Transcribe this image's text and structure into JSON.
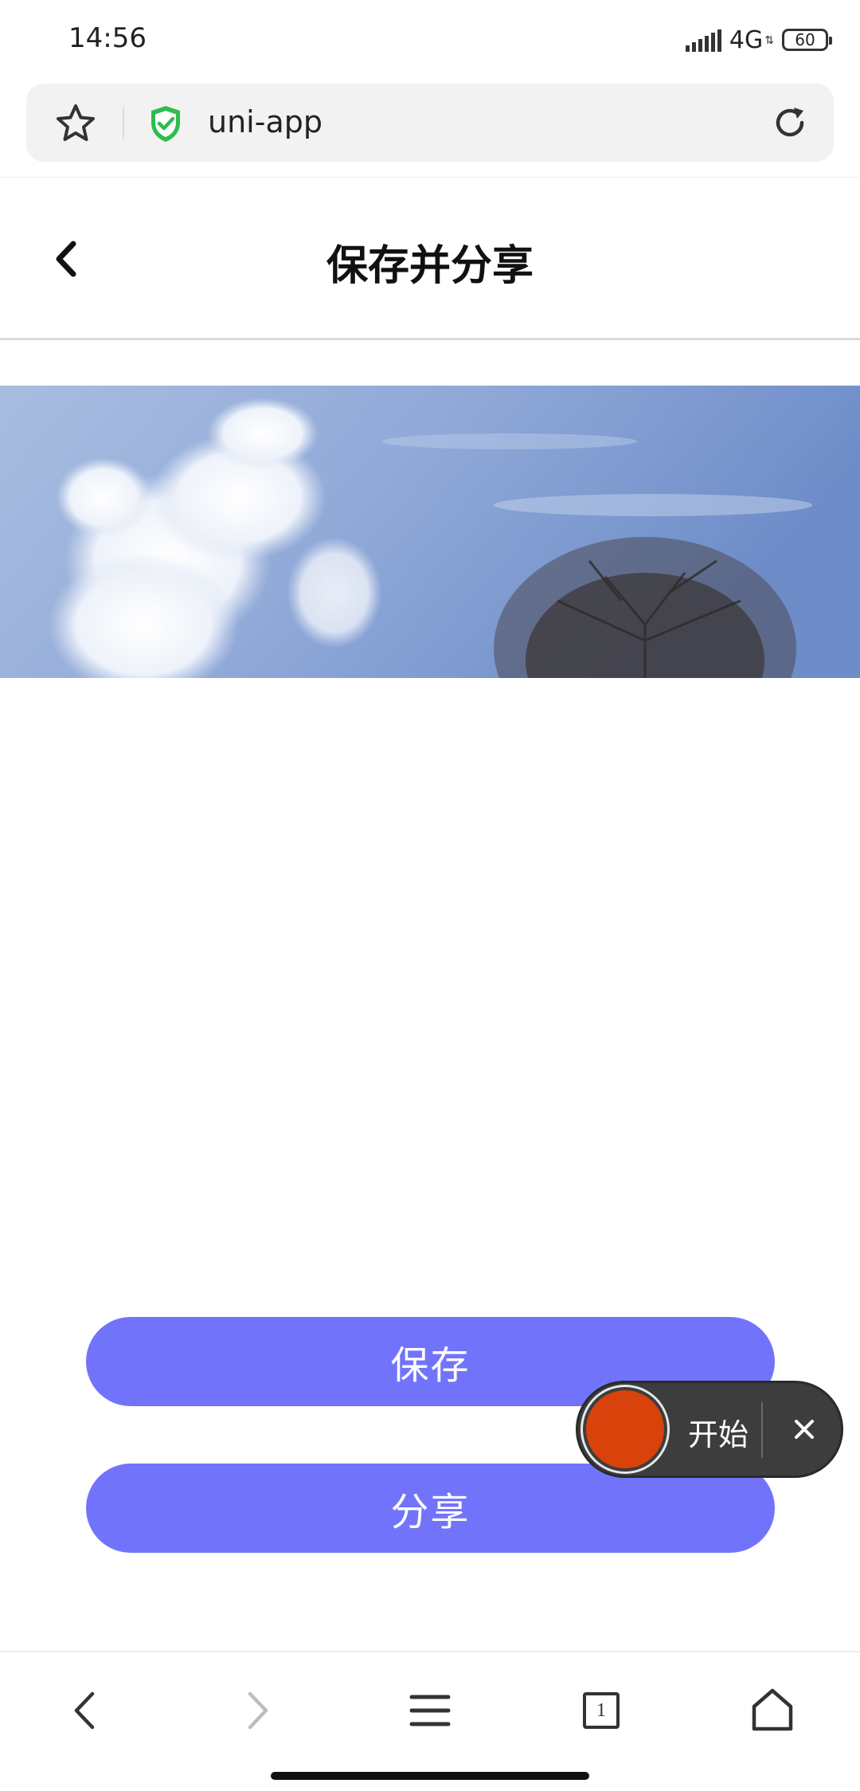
{
  "status_bar": {
    "time": "14:56",
    "network": "4G",
    "battery": "60"
  },
  "browser": {
    "url": "uni-app",
    "icons": [
      "star-icon",
      "shield-check-icon",
      "reload-icon"
    ]
  },
  "header": {
    "title": "保存并分享",
    "back_icon": "chevron-left-icon"
  },
  "image": {
    "description_colors": {
      "sky": "#7f9bd0",
      "cloud": "#ffffff",
      "tree": "#3a3434"
    }
  },
  "actions": {
    "save_label": "保存",
    "share_label": "分享",
    "button_color": "#7174fb"
  },
  "recorder": {
    "start_label": "开始",
    "dot_color": "#d9420b"
  },
  "bottom_nav": {
    "tab_count": "1",
    "icons": [
      "back-icon",
      "forward-icon",
      "menu-icon",
      "tabs-icon",
      "home-icon"
    ]
  }
}
